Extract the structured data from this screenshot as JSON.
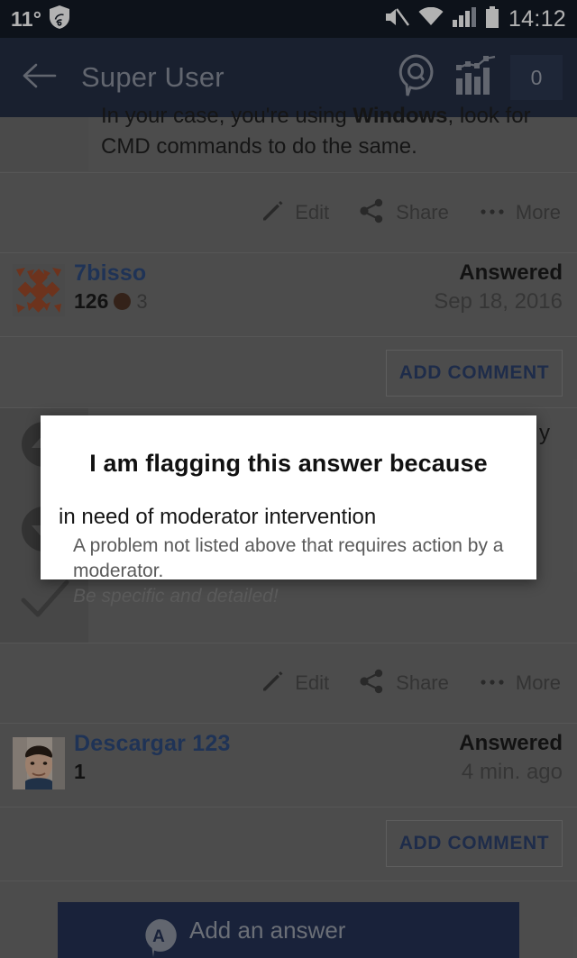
{
  "status_bar": {
    "temperature": "11°",
    "shield_icon": "shield-signal-icon",
    "mute_icon": "volume-mute-icon",
    "wifi_icon": "wifi-icon",
    "signal_icon": "cellular-signal-icon",
    "battery_icon": "battery-icon",
    "time": "14:12",
    "background": "#141a26"
  },
  "app_bar": {
    "back_icon": "back-arrow-icon",
    "title": "Super User",
    "search_icon": "question-bubble-icon",
    "stats_icon": "stats-bar-chart-icon",
    "inbox_count": "0",
    "background": "#242e44",
    "title_color": "#8d93a0"
  },
  "post": {
    "text_prefix": "In your case, you're using ",
    "text_bold": "Windows",
    "text_suffix": ", look for CMD commands to do the same."
  },
  "actions": {
    "edit_icon": "pencil-icon",
    "edit_label": "Edit",
    "share_icon": "share-icon",
    "share_label": "Share",
    "more_icon": "more-dots-icon",
    "more_label": "More"
  },
  "answer_one": {
    "avatar": "identicon-avatar",
    "username": "7bisso",
    "reputation": "126",
    "badge_icon": "bronze-badge-icon",
    "badge_count": "3",
    "status": "Answered",
    "date": "Sep 18, 2016",
    "add_comment_label": "ADD COMMENT",
    "username_color": "#2d4a7c"
  },
  "answer_two": {
    "avatar": "photo-avatar",
    "username": "Descargar 123",
    "reputation": "1",
    "status": "Answered",
    "date": "4 min. ago",
    "add_comment_label": "ADD COMMENT"
  },
  "vote_controls": {
    "upvote_icon": "upvote-arrow-icon",
    "vote_count": "-",
    "downvote_icon": "downvote-arrow-icon",
    "accepted_icon": "accepted-checkmark-icon"
  },
  "obscured_text": {
    "peek": "y"
  },
  "add_answer": {
    "icon": "answer-bubble-icon",
    "label": "Add an answer",
    "background": "#243253"
  },
  "dialog": {
    "title": "I am flagging this answer because",
    "option_title": "in need of moderator intervention",
    "option_desc": "A problem not listed above that requires action by a moderator.",
    "option_desc_italic": "Be specific and detailed!",
    "background": "#ffffff"
  }
}
